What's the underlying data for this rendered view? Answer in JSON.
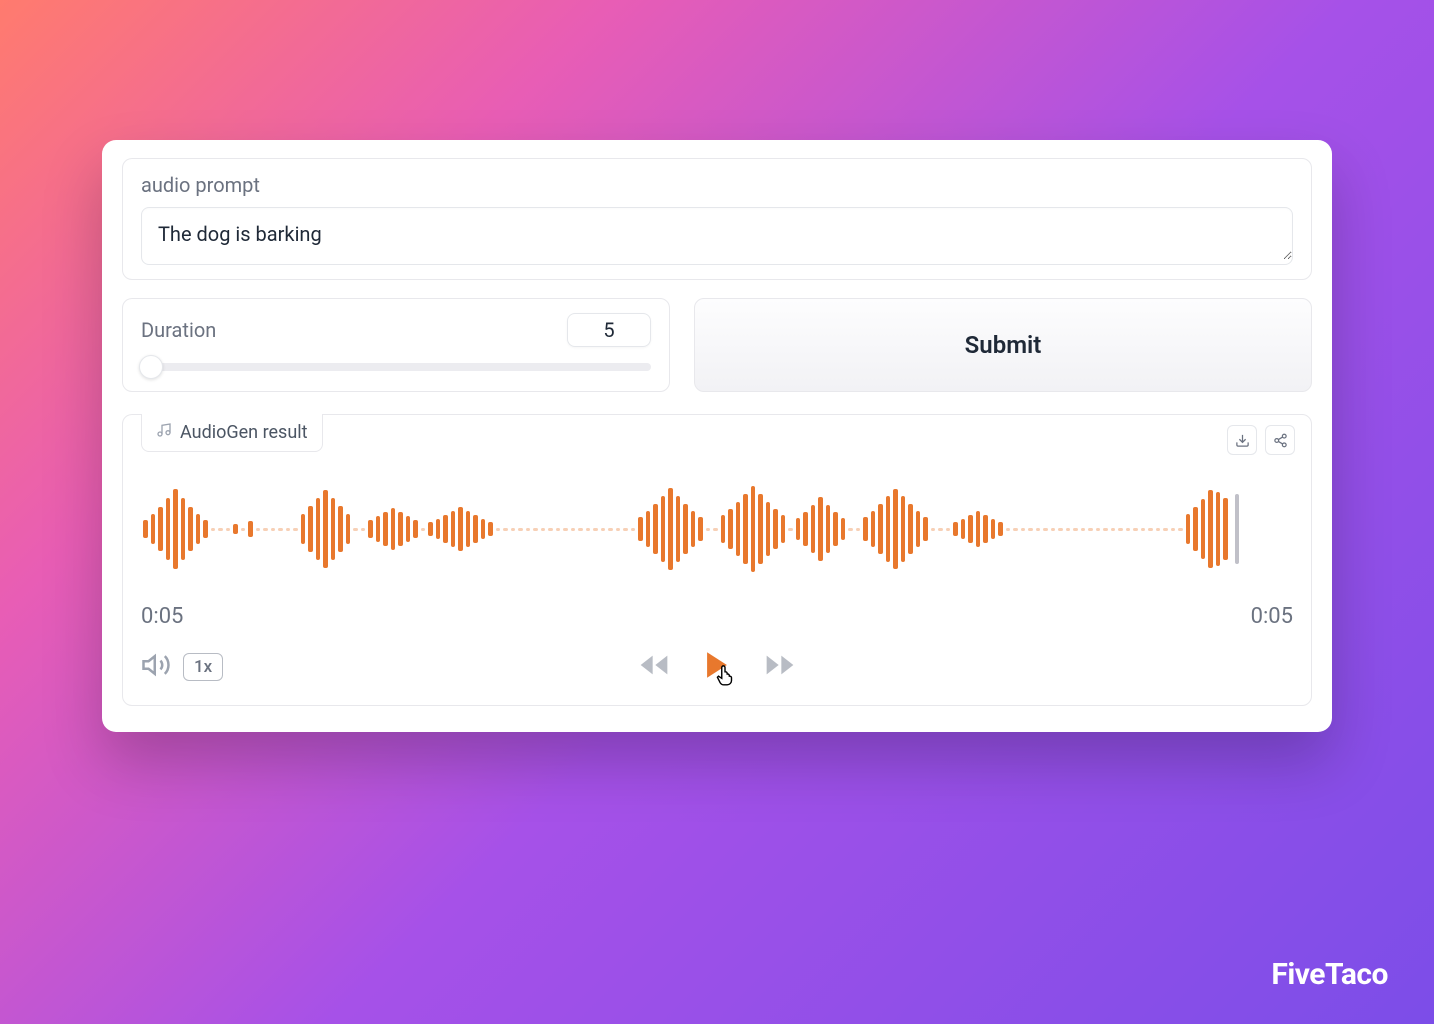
{
  "prompt": {
    "label": "audio prompt",
    "value": "The dog is barking"
  },
  "duration": {
    "label": "Duration",
    "value": "5"
  },
  "submit": {
    "label": "Submit"
  },
  "result": {
    "title": "AudioGen result",
    "current_time": "0:05",
    "total_time": "0:05",
    "speed": "1x"
  },
  "brand": "FiveTaco",
  "colors": {
    "accent": "#e8782d"
  },
  "waveform_heights": [
    18,
    30,
    44,
    62,
    80,
    62,
    44,
    30,
    18,
    3,
    3,
    3,
    10,
    3,
    16,
    3,
    3,
    3,
    3,
    3,
    3,
    30,
    46,
    62,
    78,
    62,
    46,
    30,
    3,
    3,
    18,
    26,
    34,
    42,
    34,
    26,
    18,
    3,
    14,
    20,
    28,
    36,
    44,
    36,
    28,
    20,
    14,
    3,
    3,
    3,
    3,
    3,
    3,
    3,
    3,
    3,
    3,
    3,
    3,
    3,
    3,
    3,
    3,
    3,
    3,
    3,
    24,
    36,
    50,
    66,
    82,
    66,
    50,
    36,
    24,
    3,
    3,
    28,
    40,
    54,
    70,
    86,
    70,
    54,
    40,
    28,
    3,
    22,
    34,
    48,
    64,
    48,
    34,
    22,
    3,
    3,
    24,
    36,
    50,
    66,
    80,
    66,
    50,
    36,
    24,
    3,
    3,
    3,
    14,
    20,
    28,
    36,
    28,
    20,
    14,
    3,
    3,
    3,
    3,
    3,
    3,
    3,
    3,
    3,
    3,
    3,
    3,
    3,
    3,
    3,
    3,
    3,
    3,
    3,
    3,
    3,
    3,
    3,
    3,
    30,
    44,
    60,
    78,
    74,
    62
  ]
}
